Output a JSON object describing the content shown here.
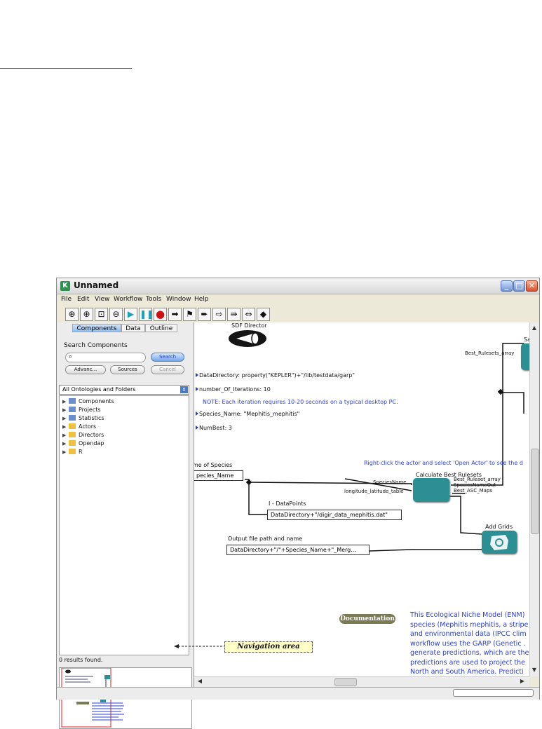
{
  "window": {
    "title": "Unnamed",
    "app_icon": "K"
  },
  "menubar": [
    "File",
    "Edit",
    "View",
    "Workflow",
    "Tools",
    "Window",
    "Help"
  ],
  "toolbar": [
    "zoom-in-icon",
    "zoom-reset-icon",
    "zoom-fit-icon",
    "zoom-out-icon",
    "run-icon",
    "pause-icon",
    "stop-icon",
    "arrow-right-icon",
    "flag-icon",
    "arrow-thick-icon",
    "arrow-outline-icon",
    "arrow-double-icon",
    "arrow-split-icon",
    "diamond-icon"
  ],
  "left_panel": {
    "tabs": [
      "Components",
      "Data",
      "Outline"
    ],
    "search_label": "Search Components",
    "search_placeholder": "",
    "buttons": {
      "search": "Search",
      "advanced": "Advanc...",
      "sources": "Sources",
      "cancel": "Cancel"
    },
    "ontology_select": "All Ontologies and Folders",
    "tree": [
      "Components",
      "Projects",
      "Statistics",
      "Actors",
      "Directors",
      "Opendap",
      "R"
    ],
    "status": "0 results found."
  },
  "canvas": {
    "director": "SDF Director",
    "params": [
      "DataDirectory: property(\"KEPLER\")+\"/lib/testdata/garp\"",
      "number_Of_Iterations: 10",
      "Species_Name: \"Mephitis_mephitis\"",
      "NumBest: 3"
    ],
    "note": "NOTE: Each iteration requires 10-20 seconds on a typical desktop PC.",
    "name_label": "me of Species",
    "name_value": "pecies_Name",
    "right_click_note": "Right-click the actor and select 'Open Actor' to see the d",
    "datapoints_label": "I - DataPoints",
    "datapoints_value": "DataDirectory+\"/digir_data_mephitis.dat\"",
    "output_label": "Output file path and name",
    "output_value": "DataDirectory+\"/\"+Species_Name+\"_Merg...",
    "calc_title": "Calculate Best Rulesets",
    "calc_ports_in": [
      "SpeciesName",
      "longitude_latitude_table"
    ],
    "calc_ports_out": [
      "Best_Ruleset_array",
      "SpeciesNameOut",
      "Best_ASC_Maps"
    ],
    "best_rulesets_array": "Best_Rulesets_array",
    "partial_actor": "Sa",
    "add_grids": "Add Grids",
    "documentation": "Documentation",
    "doc_text": [
      "This Ecological Niche Model (ENM)",
      "species (Mephitis mephitis, a stripe",
      "and environmental data (IPCC clim",
      "workflow uses the GARP (Genetic .",
      "generate predictions, which are the",
      "predictions are used to project the",
      "North and South America. Predicti"
    ]
  },
  "annotation": {
    "navigation_area": "Navigation area"
  }
}
